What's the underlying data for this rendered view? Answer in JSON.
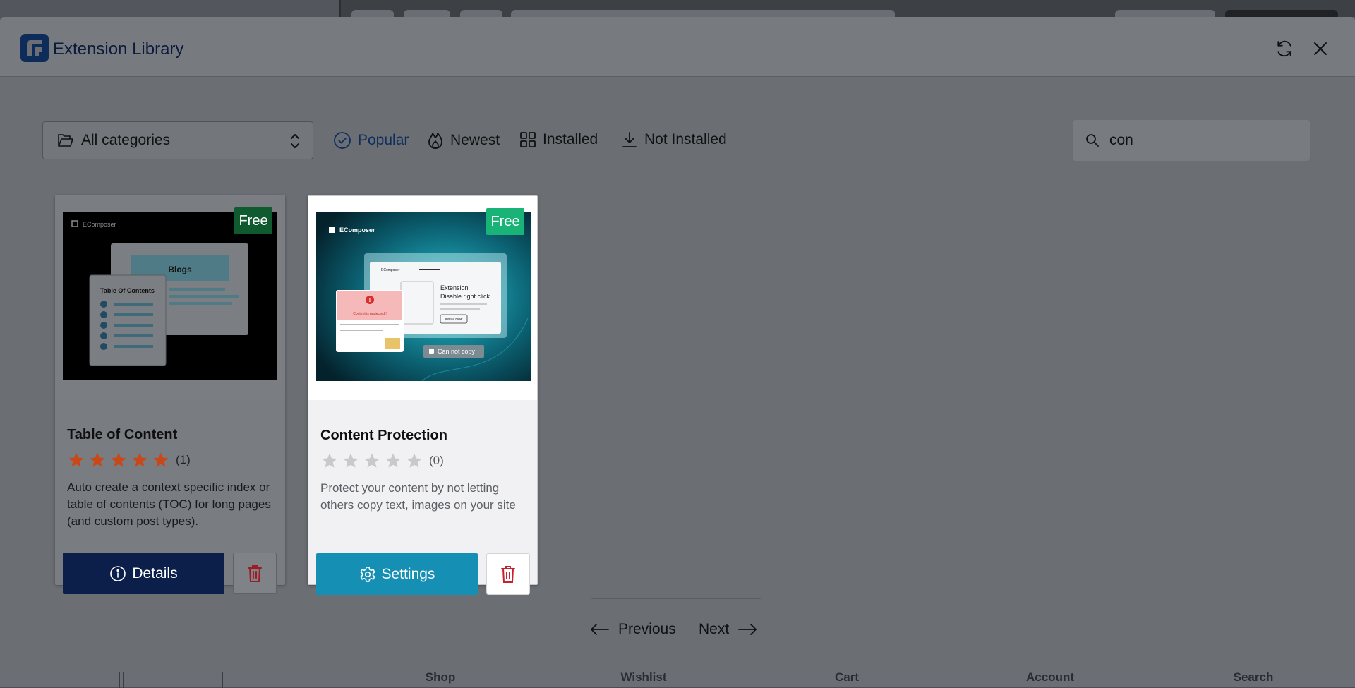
{
  "background": {
    "bottom_nav": [
      "Shop",
      "Wishlist",
      "Cart",
      "Account",
      "Search"
    ]
  },
  "modal": {
    "title": "Extension Library"
  },
  "toolbar": {
    "category": "All categories",
    "tabs": [
      {
        "label": "Popular",
        "icon": "check-circle-icon",
        "active": true
      },
      {
        "label": "Newest",
        "icon": "flame-icon",
        "active": false
      },
      {
        "label": "Installed",
        "icon": "grid-icon",
        "active": false
      },
      {
        "label": "Not Installed",
        "icon": "download-icon",
        "active": false
      }
    ],
    "search_value": "con"
  },
  "cards": [
    {
      "title": "Table of Content",
      "badge": "Free",
      "rating": 5,
      "rating_count": "(1)",
      "description": "Auto create a context specific index or table of contents (TOC) for long pages (and custom post types).",
      "primary_label": "Details",
      "thumb": {
        "brand": "EComposer",
        "blog_label": "Blogs",
        "toc_label": "Table Of Contents"
      }
    },
    {
      "title": "Content Protection",
      "badge": "Free",
      "rating": 0,
      "rating_count": "(0)",
      "description": "Protect your content by not letting others copy text, images on your site",
      "primary_label": "Settings",
      "thumb": {
        "brand": "EComposer",
        "ext_line1": "Extension",
        "ext_line2": "Disable right click",
        "install_btn": "Install Now",
        "protected_text": "Content is protected !",
        "cannot_copy": "Can not copy"
      }
    }
  ],
  "pagination": {
    "previous": "Previous",
    "next": "Next"
  },
  "colors": {
    "details_button": "#0b1f4a",
    "settings_button": "#1590b4",
    "badge_dim": "#0f5a2e",
    "badge_bright": "#19b378",
    "star_filled": "#c8481a",
    "star_empty": "#c9c9cc",
    "delete_icon": "#c8212d"
  }
}
